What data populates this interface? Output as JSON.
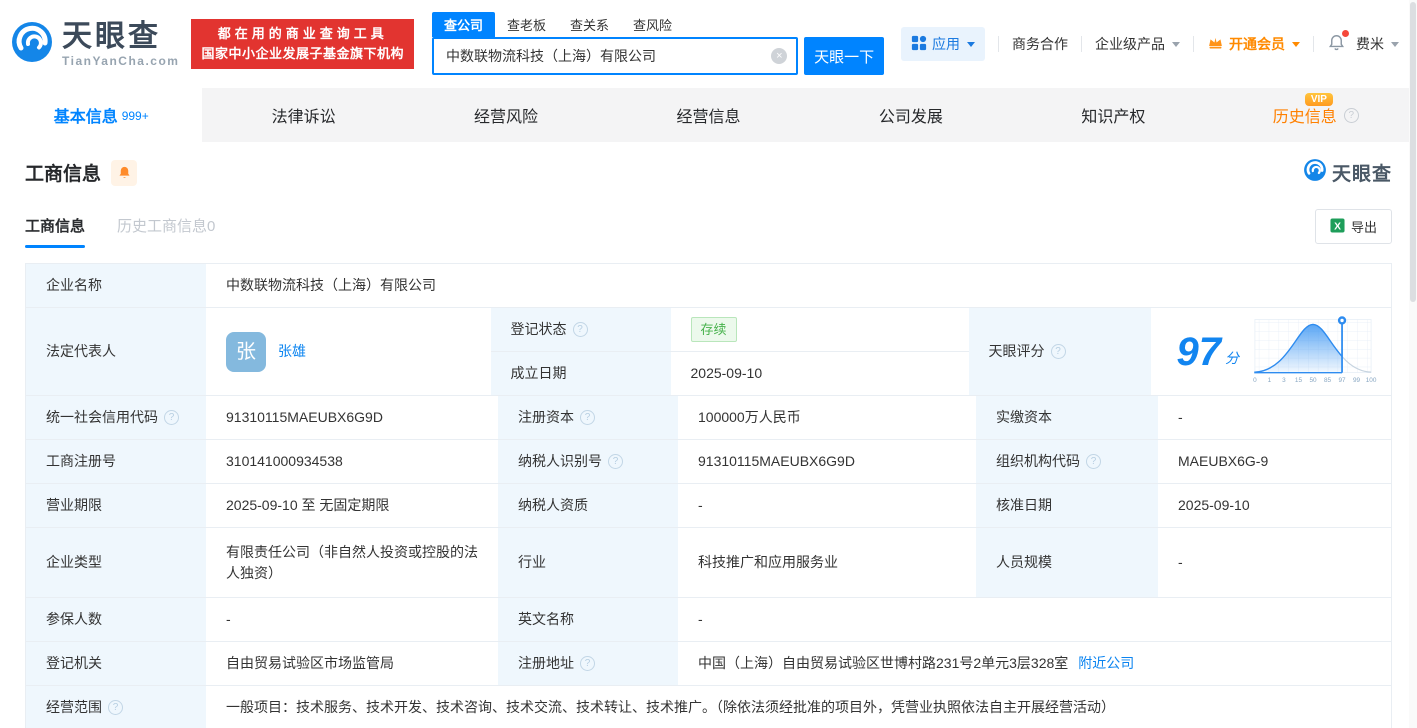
{
  "icons": {
    "help": "?",
    "clear": "×",
    "excel_x": "X"
  },
  "colors": {
    "primary_blue": "#0084ff",
    "brand_red": "#e23430",
    "vip_orange": "#ff8a00",
    "status_green": "#47b24c",
    "score_blue": "#1285f0",
    "label_bg": "#eff7fd"
  },
  "header": {
    "logo": {
      "brand": "天眼查",
      "domain": "TianYanCha.com"
    },
    "promo": {
      "line1": "都在用的商业查询工具",
      "line2": "国家中小企业发展子基金旗下机构"
    },
    "search": {
      "tabs": [
        {
          "label": "查公司"
        },
        {
          "label": "查老板"
        },
        {
          "label": "查关系"
        },
        {
          "label": "查风险"
        }
      ],
      "value": "中数联物流科技（上海）有限公司",
      "button": "天眼一下"
    },
    "menu": {
      "apps": "应用",
      "cooperation": "商务合作",
      "enterprise": "企业级产品",
      "vip": "开通会员",
      "username": "费米"
    }
  },
  "nav_tabs": [
    {
      "label": "基本信息",
      "badge": "999+"
    },
    {
      "label": "法律诉讼"
    },
    {
      "label": "经营风险"
    },
    {
      "label": "经营信息"
    },
    {
      "label": "公司发展"
    },
    {
      "label": "知识产权"
    },
    {
      "label": "历史信息",
      "vip_badge": "VIP"
    }
  ],
  "section": {
    "title": "工商信息",
    "watermark": "天眼查",
    "subtabs": [
      {
        "label": "工商信息"
      },
      {
        "label": "历史工商信息0"
      }
    ],
    "export_label": "导出"
  },
  "info": {
    "company_name": {
      "label": "企业名称",
      "value": "中数联物流科技（上海）有限公司"
    },
    "legal_rep": {
      "label": "法定代表人",
      "avatar": "张",
      "name": "张雄"
    },
    "reg_status": {
      "label": "登记状态",
      "value": "存续"
    },
    "establish_date": {
      "label": "成立日期",
      "value": "2025-09-10"
    },
    "score": {
      "label": "天眼评分",
      "value": "97",
      "unit": "分",
      "ticks": [
        "0",
        "1",
        "3",
        "15",
        "50",
        "85",
        "97",
        "99",
        "100"
      ]
    },
    "credit_code": {
      "label": "统一社会信用代码",
      "value": "91310115MAEUBX6G9D"
    },
    "reg_capital": {
      "label": "注册资本",
      "value": "100000万人民币"
    },
    "paid_capital": {
      "label": "实缴资本",
      "value": "-"
    },
    "reg_number": {
      "label": "工商注册号",
      "value": "310141000934538"
    },
    "taxpayer_id": {
      "label": "纳税人识别号",
      "value": "91310115MAEUBX6G9D"
    },
    "org_code": {
      "label": "组织机构代码",
      "value": "MAEUBX6G-9"
    },
    "business_term": {
      "label": "营业期限",
      "value": "2025-09-10 至 无固定期限"
    },
    "taxpayer_quality": {
      "label": "纳税人资质",
      "value": "-"
    },
    "approval_date": {
      "label": "核准日期",
      "value": "2025-09-10"
    },
    "company_type": {
      "label": "企业类型",
      "value": "有限责任公司（非自然人投资或控股的法人独资）"
    },
    "industry": {
      "label": "行业",
      "value": "科技推广和应用服务业"
    },
    "staff_size": {
      "label": "人员规模",
      "value": "-"
    },
    "insured_count": {
      "label": "参保人数",
      "value": "-"
    },
    "english_name": {
      "label": "英文名称",
      "value": "-"
    },
    "reg_authority": {
      "label": "登记机关",
      "value": "自由贸易试验区市场监管局"
    },
    "reg_address": {
      "label": "注册地址",
      "value": "中国（上海）自由贸易试验区世博村路231号2单元3层328室",
      "link": "附近公司"
    },
    "business_scope": {
      "label": "经营范围",
      "value": "一般项目：技术服务、技术开发、技术咨询、技术交流、技术转让、技术推广。（除依法须经批准的项目外，凭营业执照依法自主开展经营活动）"
    }
  }
}
